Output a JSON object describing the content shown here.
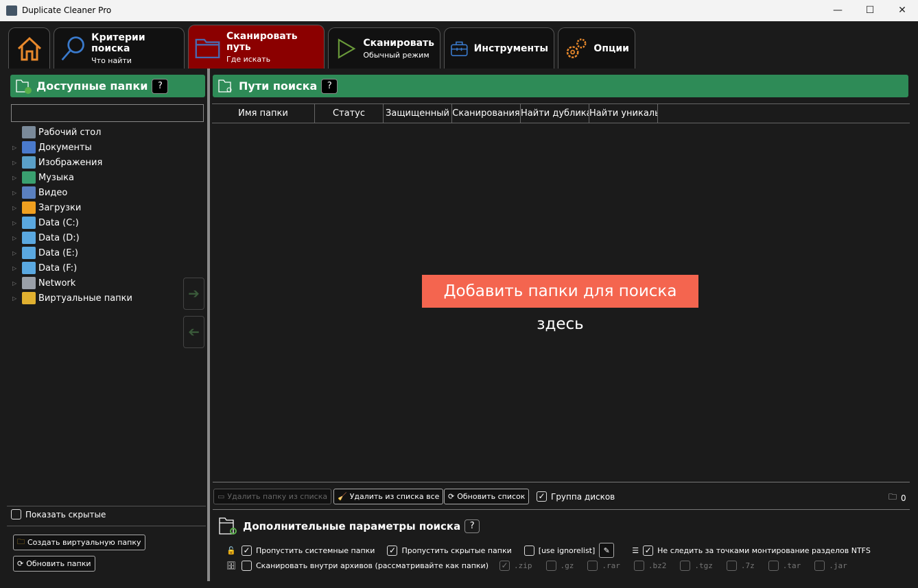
{
  "window": {
    "title": "Duplicate Cleaner Pro",
    "minimize": "—",
    "maximize": "☐",
    "close": "✕"
  },
  "tabs": [
    {
      "id": "home",
      "icon": "home-icon"
    },
    {
      "id": "criteria",
      "l1": "Критерии поиска",
      "l2": "Что найти"
    },
    {
      "id": "scanpath",
      "l1": "Сканировать путь",
      "l2": "Где искать",
      "active": true
    },
    {
      "id": "scan",
      "l1": "Сканировать",
      "l2": "Обычный режим"
    },
    {
      "id": "tools",
      "l1": "Инструменты"
    },
    {
      "id": "options",
      "l1": "Опции"
    }
  ],
  "left": {
    "title": "Доступные папки",
    "help": "?",
    "search_value": "",
    "tree": [
      {
        "label": "Рабочий стол",
        "color": "#7a8a9a",
        "exp": false
      },
      {
        "label": "Документы",
        "color": "#4a7acc",
        "exp": true
      },
      {
        "label": "Изображения",
        "color": "#5aa0c8",
        "exp": true
      },
      {
        "label": "Музыка",
        "color": "#3aa070",
        "exp": true
      },
      {
        "label": "Видео",
        "color": "#5a80c0",
        "exp": true
      },
      {
        "label": "Загрузки",
        "color": "#f0a020",
        "exp": true
      },
      {
        "label": "Data (C:)",
        "color": "#5aa8e0",
        "exp": true
      },
      {
        "label": "Data (D:)",
        "color": "#5aa8e0",
        "exp": true
      },
      {
        "label": "Data (E:)",
        "color": "#5aa8e0",
        "exp": true
      },
      {
        "label": "Data (F:)",
        "color": "#5aa8e0",
        "exp": true
      },
      {
        "label": "Network",
        "color": "#9aa0a8",
        "exp": true
      },
      {
        "label": "Виртуальные папки",
        "color": "#e0b030",
        "exp": true
      }
    ],
    "show_hidden": "Показать скрытые",
    "create_virtual": "Создать виртуальную папку",
    "refresh": "Обновить папки"
  },
  "right": {
    "title": "Пути поиска",
    "help": "?",
    "columns": [
      "Имя папки",
      "Статус",
      "Защищенный",
      "Сканирования",
      "Найти дублика",
      "Найти уникаль"
    ],
    "placeholder": "Добавить папки для поиска здесь",
    "remove": "Удалить папку из списка",
    "remove_all": "Удалить из списка все",
    "refresh": "Обновить список",
    "group_disks": "Группа дисков",
    "folder_count": "0",
    "adv_title": "Дополнительные параметры поиска",
    "adv_help": "?",
    "skip_system": "Пропустить системные папки",
    "skip_hidden": "Пропустить скрытые папки",
    "ignorelist": "[use ignorelist]",
    "ntfs": "Не следить за точками монтирование разделов NTFS",
    "archives": "Сканировать внутри архивов (рассматривайте как папки)",
    "exts": [
      {
        "e": ".zip",
        "c": true
      },
      {
        "e": ".gz",
        "c": false
      },
      {
        "e": ".rar",
        "c": false
      },
      {
        "e": ".bz2",
        "c": false
      },
      {
        "e": ".tgz",
        "c": false
      },
      {
        "e": ".7z",
        "c": false
      },
      {
        "e": ".tar",
        "c": false
      },
      {
        "e": ".jar",
        "c": false
      }
    ]
  },
  "colors": {
    "accent_green": "#2e8b57",
    "active_tab": "#8b0000",
    "placeholder_bg": "#f4654f"
  }
}
